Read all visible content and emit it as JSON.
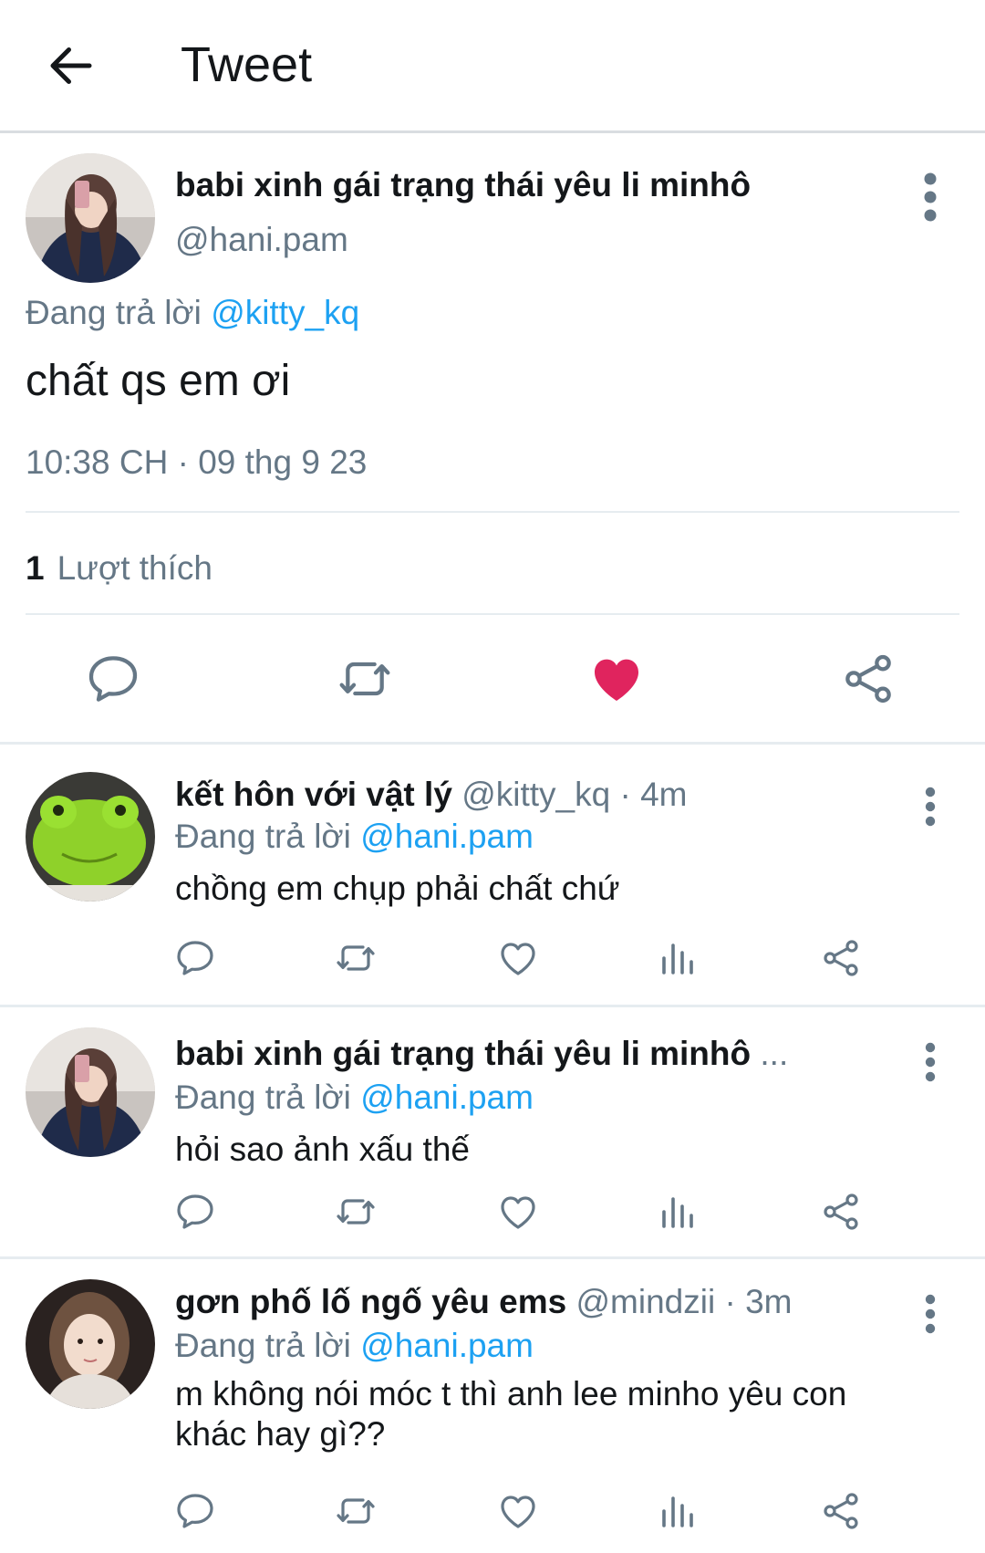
{
  "header": {
    "title": "Tweet"
  },
  "main_tweet": {
    "author_name": "babi xinh gái trạng thái yêu li minhô",
    "handle": "@hani.pam",
    "reply_prefix": "Đang trả lời",
    "reply_to": "@kitty_kq",
    "text": "chất qs em ơi",
    "timestamp": "10:38 CH · 09 thg 9 23",
    "like_count": "1",
    "like_label": "Lượt thích",
    "liked": true,
    "colors": {
      "like": "#e0245e",
      "link": "#1da1f2",
      "secondary": "#657786"
    }
  },
  "replies": [
    {
      "author_name": "kết hôn với vật lý",
      "handle": "@kitty_kq",
      "time": "· 4m",
      "reply_prefix": "Đang trả lời",
      "reply_to": "@hani.pam",
      "text": "chồng em chụp phải chất chứ"
    },
    {
      "author_name": "babi xinh gái trạng thái yêu li minhô",
      "handle": "...",
      "time": "",
      "reply_prefix": "Đang trả lời",
      "reply_to": "@hani.pam",
      "text": "hỏi sao ảnh xấu thế"
    },
    {
      "author_name": "gơn phố lố ngố yêu ems",
      "handle": "@mindzii",
      "time": "· 3m",
      "reply_prefix": "Đang trả lời",
      "reply_to": "@hani.pam",
      "text": "m không nói móc t thì anh lee minho yêu con khác hay gì??"
    }
  ],
  "icons": {
    "back": "arrow-left-icon",
    "more": "kebab-menu-icon",
    "reply": "speech-bubble-icon",
    "retweet": "retweet-icon",
    "like": "heart-icon",
    "analytics": "bar-chart-icon",
    "share": "share-icon"
  }
}
